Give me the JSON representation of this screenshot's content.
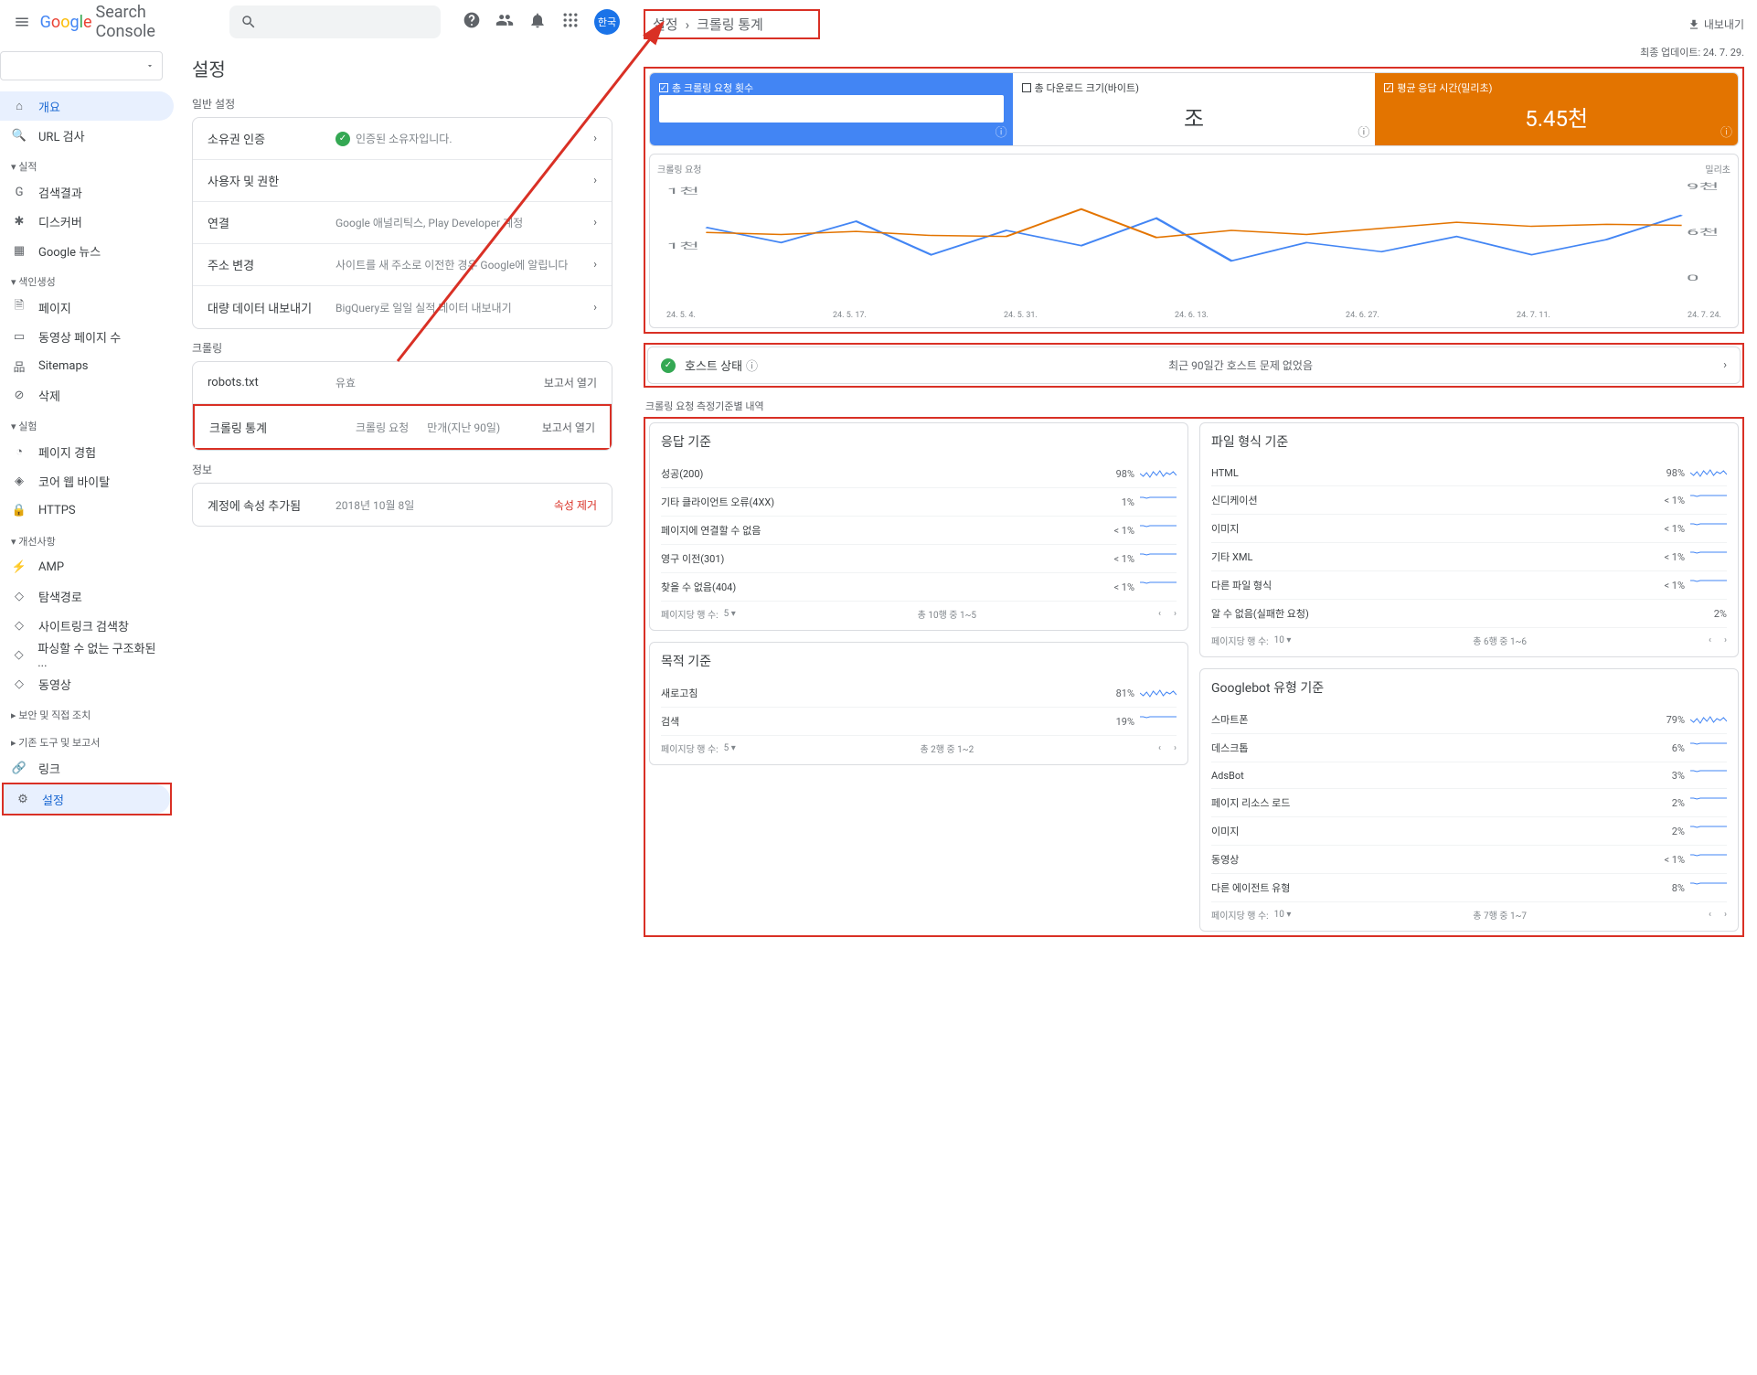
{
  "header": {
    "logo_text": "Search Console",
    "avatar_text": "한국"
  },
  "sidebar": {
    "overview": "개요",
    "url_inspect": "URL 검사",
    "grp_performance": "실적",
    "search_results": "검색결과",
    "discover": "디스커버",
    "google_news": "Google 뉴스",
    "grp_indexing": "색인생성",
    "pages": "페이지",
    "video_pages": "동영상 페이지 수",
    "sitemaps": "Sitemaps",
    "removals": "삭제",
    "grp_experience": "실험",
    "page_experience": "페이지 경험",
    "core_web_vitals": "코어 웹 바이탈",
    "https": "HTTPS",
    "grp_enhancements": "개선사항",
    "amp": "AMP",
    "breadcrumbs": "탐색경로",
    "sitelinks_search": "사이트링크 검색창",
    "unparseable": "파싱할 수 없는 구조화된 ...",
    "videos": "동영상",
    "grp_security": "보안 및 직접 조치",
    "grp_legacy": "기존 도구 및 보고서",
    "links": "링크",
    "settings": "설정"
  },
  "main": {
    "title": "설정",
    "general_label": "일반 설정",
    "rows": {
      "ownership": {
        "label": "소유권 인증",
        "desc": "인증된 소유자입니다."
      },
      "users": {
        "label": "사용자 및 권한"
      },
      "associations": {
        "label": "연결",
        "desc": "Google 애널리틱스, Play Developer 계정"
      },
      "address_change": {
        "label": "주소 변경",
        "desc": "사이트를 새 주소로 이전한 경우 Google에 알립니다"
      },
      "bulk_export": {
        "label": "대량 데이터 내보내기",
        "desc": "BigQuery로 일일 실적 데이터 내보내기"
      }
    },
    "crawling_label": "크롤링",
    "robots": {
      "label": "robots.txt",
      "desc": "유효",
      "open": "보고서 열기"
    },
    "crawl_stats": {
      "label": "크롤링 통계",
      "req": "크롤링 요청",
      "count": "만개(지난 90일)",
      "open": "보고서 열기"
    },
    "info_label": "정보",
    "property_added": {
      "label": "계정에 속성 추가됨",
      "date": "2018년 10월 8일",
      "remove": "속성 제거"
    }
  },
  "right": {
    "bc_settings": "설정",
    "bc_crawl": "크롤링 통계",
    "export": "내보내기",
    "last_update": "최종 업데이트: 24. 7. 29.",
    "metrics": {
      "total_requests": "총 크롤링 요청 횟수",
      "download_size": "총 다운로드 크기(바이트)",
      "download_value": "조",
      "avg_response": "평균 응답 시간(밀리초)",
      "avg_value": "5.45천"
    },
    "chart_left_label": "크롤링 요청",
    "chart_right_label": "밀리초",
    "y_left": [
      "1천",
      "1천"
    ],
    "y_right": [
      "9천",
      "6천",
      "0"
    ],
    "x_ticks": [
      "24. 5. 4.",
      "24. 5. 17.",
      "24. 5. 31.",
      "24. 6. 13.",
      "24. 6. 27.",
      "24. 7. 11.",
      "24. 7. 24."
    ],
    "host": {
      "title": "호스트 상태",
      "desc": "최근 90일간 호스트 문제 없었음"
    },
    "breakdown_label": "크롤링 요청 측정기준별 내역",
    "cards": {
      "response": {
        "title": "응답 기준",
        "rows": [
          {
            "name": "성공(200)",
            "pct": "98%"
          },
          {
            "name": "기타 클라이언트 오류(4XX)",
            "pct": "1%"
          },
          {
            "name": "페이지에 연결할 수 없음",
            "pct": "< 1%"
          },
          {
            "name": "영구 이전(301)",
            "pct": "< 1%"
          },
          {
            "name": "찾을 수 없음(404)",
            "pct": "< 1%"
          }
        ],
        "footer": {
          "per": "페이지당 행 수:",
          "n": "5",
          "range": "총 10행 중 1~5"
        }
      },
      "filetype": {
        "title": "파일 형식 기준",
        "rows": [
          {
            "name": "HTML",
            "pct": "98%"
          },
          {
            "name": "신디케이션",
            "pct": "< 1%"
          },
          {
            "name": "이미지",
            "pct": "< 1%"
          },
          {
            "name": "기타 XML",
            "pct": "< 1%"
          },
          {
            "name": "다른 파일 형식",
            "pct": "< 1%"
          }
        ],
        "extra": {
          "name": "알 수 없음(실패한 요청)",
          "pct": "2%"
        },
        "footer": {
          "per": "페이지당 행 수:",
          "n": "10",
          "range": "총 6행 중 1~6"
        }
      },
      "purpose": {
        "title": "목적 기준",
        "rows": [
          {
            "name": "새로고침",
            "pct": "81%"
          },
          {
            "name": "검색",
            "pct": "19%"
          }
        ],
        "footer": {
          "per": "페이지당 행 수:",
          "n": "5",
          "range": "총 2행 중 1~2"
        }
      },
      "googlebot": {
        "title": "Googlebot 유형 기준",
        "rows": [
          {
            "name": "스마트폰",
            "pct": "79%"
          },
          {
            "name": "데스크톱",
            "pct": "6%"
          },
          {
            "name": "AdsBot",
            "pct": "3%"
          },
          {
            "name": "페이지 리소스 로드",
            "pct": "2%"
          },
          {
            "name": "이미지",
            "pct": "2%"
          },
          {
            "name": "동영상",
            "pct": "< 1%"
          },
          {
            "name": "다른 에이전트 유형",
            "pct": "8%"
          }
        ],
        "footer": {
          "per": "페이지당 행 수:",
          "n": "10",
          "range": "총 7행 중 1~7"
        }
      }
    }
  },
  "chart_data": {
    "type": "line",
    "x": [
      "24.5.4",
      "24.5.10",
      "24.5.17",
      "24.5.24",
      "24.5.31",
      "24.6.6",
      "24.6.13",
      "24.6.20",
      "24.6.27",
      "24.7.4",
      "24.7.11",
      "24.7.18",
      "24.7.24",
      "24.7.29"
    ],
    "series": [
      {
        "name": "크롤링 요청",
        "axis": "left",
        "color": "#4285f4",
        "values": [
          950,
          700,
          1050,
          500,
          900,
          650,
          1100,
          400,
          700,
          550,
          800,
          500,
          750,
          1150
        ]
      },
      {
        "name": "평균 응답 시간(밀리초)",
        "axis": "right",
        "color": "#e37400",
        "values": [
          5200,
          5000,
          5300,
          4900,
          4800,
          7500,
          4700,
          5400,
          5000,
          5600,
          6200,
          5800,
          6000,
          5900
        ]
      }
    ],
    "ylim_left": [
      0,
      1500
    ],
    "ylim_right": [
      0,
      9000
    ]
  }
}
